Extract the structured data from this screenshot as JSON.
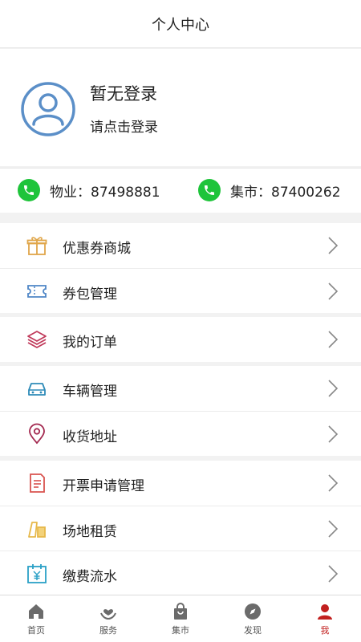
{
  "header": {
    "title": "个人中心"
  },
  "profile": {
    "name": "暂无登录",
    "prompt": "请点击登录"
  },
  "phones": [
    {
      "label": "物业：87498881"
    },
    {
      "label": "集市：87400262"
    }
  ],
  "menu": [
    {
      "label": "优惠券商城",
      "icon": "gift-icon",
      "color": "#e0a64a"
    },
    {
      "label": "券包管理",
      "icon": "ticket-icon",
      "color": "#4f86c6"
    },
    {
      "label": "我的订单",
      "icon": "layers-icon",
      "color": "#c0395a"
    },
    {
      "label": "车辆管理",
      "icon": "car-icon",
      "color": "#2e8bb8"
    },
    {
      "label": "收货地址",
      "icon": "location-pin-icon",
      "color": "#a3284f"
    },
    {
      "label": "开票申请管理",
      "icon": "invoice-icon",
      "color": "#d9534f"
    },
    {
      "label": "场地租赁",
      "icon": "venue-icon",
      "color": "#e6b84a"
    },
    {
      "label": "缴费流水",
      "icon": "calendar-yen-icon",
      "color": "#2aa0c6"
    }
  ],
  "tabs": [
    {
      "label": "首页",
      "icon": "home-icon"
    },
    {
      "label": "服务",
      "icon": "service-icon"
    },
    {
      "label": "集市",
      "icon": "shopping-bag-icon"
    },
    {
      "label": "发现",
      "icon": "compass-icon"
    },
    {
      "label": "我",
      "icon": "person-icon",
      "active": true
    }
  ],
  "colors": {
    "accent": "#c2201f",
    "phone": "#1ec43a",
    "avatar": "#5b8fc8"
  }
}
